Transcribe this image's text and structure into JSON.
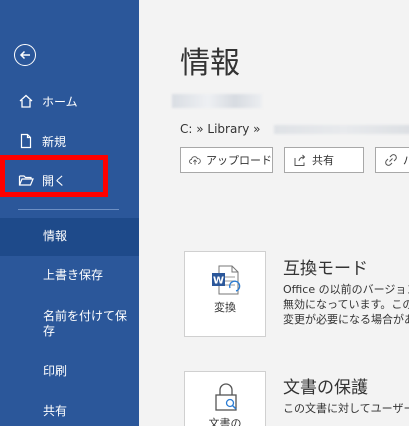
{
  "sidebar": {
    "nav": [
      {
        "label": "ホーム",
        "icon": "home-icon"
      },
      {
        "label": "新規",
        "icon": "new-document-icon"
      },
      {
        "label": "開く",
        "icon": "folder-open-icon"
      }
    ],
    "sub": [
      {
        "label": "情報",
        "active": true
      },
      {
        "label": "上書き保存"
      },
      {
        "label": "名前を付けて保存"
      },
      {
        "label": "印刷"
      },
      {
        "label": "共有"
      }
    ]
  },
  "main": {
    "title": "情報",
    "path": "C: » Library »",
    "buttons": [
      {
        "label": "アップロード",
        "icon": "cloud-upload-icon"
      },
      {
        "label": "共有",
        "icon": "share-icon"
      },
      {
        "label": "パ",
        "icon": "link-icon"
      }
    ],
    "sections": [
      {
        "card_label": "変換",
        "title": "互換モード",
        "desc": [
          "Office の以前のバージョン",
          "無効になっています。このフ",
          "変更が必要になる場合があ"
        ]
      },
      {
        "card_label": "文書の",
        "title": "文書の保護",
        "desc": [
          "この文書に対してユーザーが"
        ]
      }
    ]
  },
  "colors": {
    "sidebar": "#2b579a",
    "active": "#1e4a8a",
    "highlight": "#ff0000"
  }
}
